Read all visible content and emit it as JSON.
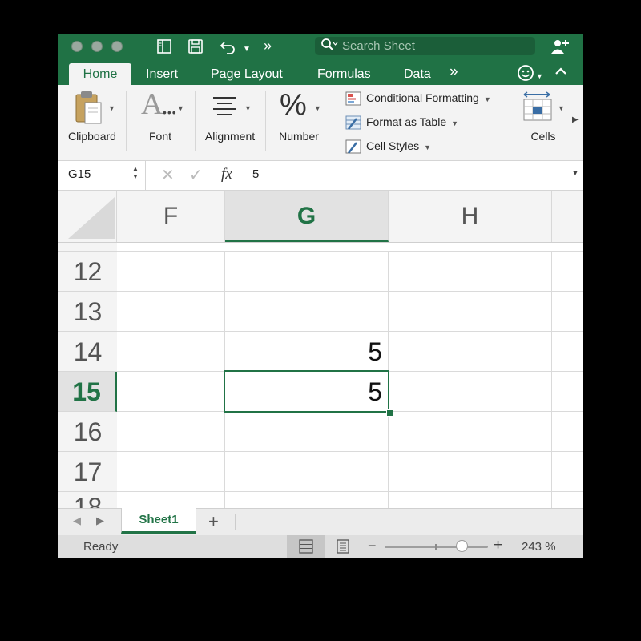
{
  "search": {
    "placeholder": "Search Sheet"
  },
  "tabs": [
    "Home",
    "Insert",
    "Page Layout",
    "Formulas",
    "Data"
  ],
  "ribbon": {
    "clipboard": "Clipboard",
    "font": "Font",
    "alignment": "Alignment",
    "number": "Number",
    "conditional_formatting": "Conditional Formatting",
    "format_as_table": "Format as Table",
    "cell_styles": "Cell Styles",
    "cells": "Cells"
  },
  "formula_bar": {
    "name_box": "G15",
    "fx": "fx",
    "value": "5"
  },
  "columns": [
    "F",
    "G",
    "H"
  ],
  "rows": [
    "12",
    "13",
    "14",
    "15",
    "16",
    "17"
  ],
  "cells": {
    "G14": "5",
    "G15": "5"
  },
  "sheet_tabs": [
    "Sheet1"
  ],
  "status": {
    "text": "Ready",
    "zoom": "243 %",
    "zoom_level_fraction": 0.75
  },
  "colors": {
    "accent": "#207245",
    "selection": "#217346"
  }
}
